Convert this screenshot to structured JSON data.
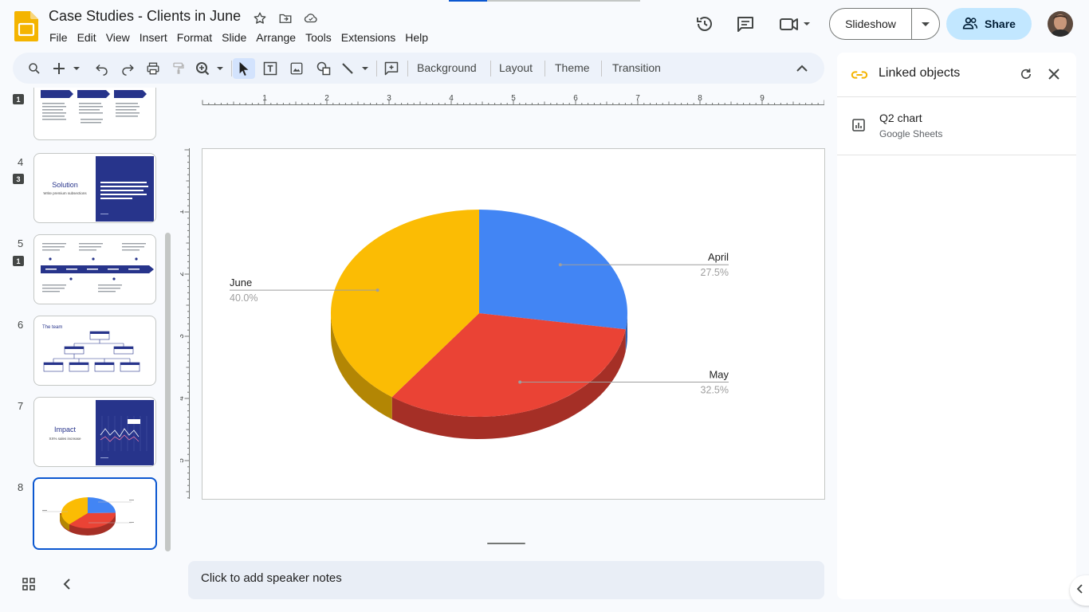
{
  "document": {
    "title": "Case Studies - Clients in June"
  },
  "menu": [
    "File",
    "Edit",
    "View",
    "Insert",
    "Format",
    "Slide",
    "Arrange",
    "Tools",
    "Extensions",
    "Help"
  ],
  "header": {
    "slideshow_label": "Slideshow",
    "share_label": "Share"
  },
  "toolbar": {
    "background_label": "Background",
    "layout_label": "Layout",
    "theme_label": "Theme",
    "transition_label": "Transition"
  },
  "filmstrip": {
    "slides": [
      {
        "number": "",
        "badge": "1",
        "title": ""
      },
      {
        "number": "4",
        "badge": "3",
        "title": "Solution",
        "subtitle": "Write premium subsections"
      },
      {
        "number": "5",
        "badge": "1",
        "title": ""
      },
      {
        "number": "6",
        "badge": "",
        "title": "The team"
      },
      {
        "number": "7",
        "badge": "",
        "title": "Impact",
        "subtitle": "XX% sales increase"
      },
      {
        "number": "8",
        "badge": "",
        "title": ""
      }
    ]
  },
  "ruler": {
    "h_ticks": [
      "1",
      "2",
      "3",
      "4",
      "5",
      "6",
      "7",
      "8",
      "9"
    ],
    "v_ticks": [
      "1",
      "2",
      "3",
      "4",
      "5"
    ]
  },
  "chart_data": {
    "type": "pie",
    "categories": [
      "April",
      "May",
      "June"
    ],
    "values": [
      27.5,
      32.5,
      40.0
    ],
    "percent_labels": [
      "27.5%",
      "32.5%",
      "40.0%"
    ],
    "colors": [
      "#4285f4",
      "#ea4335",
      "#fbbc04"
    ],
    "side_colors": [
      "#2f5fb0",
      "#a52f26",
      "#b38604"
    ],
    "three_d": true,
    "labels_outside": true
  },
  "notes": {
    "placeholder": "Click to add speaker notes"
  },
  "side_panel": {
    "title": "Linked objects",
    "items": [
      {
        "title": "Q2 chart",
        "source": "Google Sheets"
      }
    ]
  }
}
